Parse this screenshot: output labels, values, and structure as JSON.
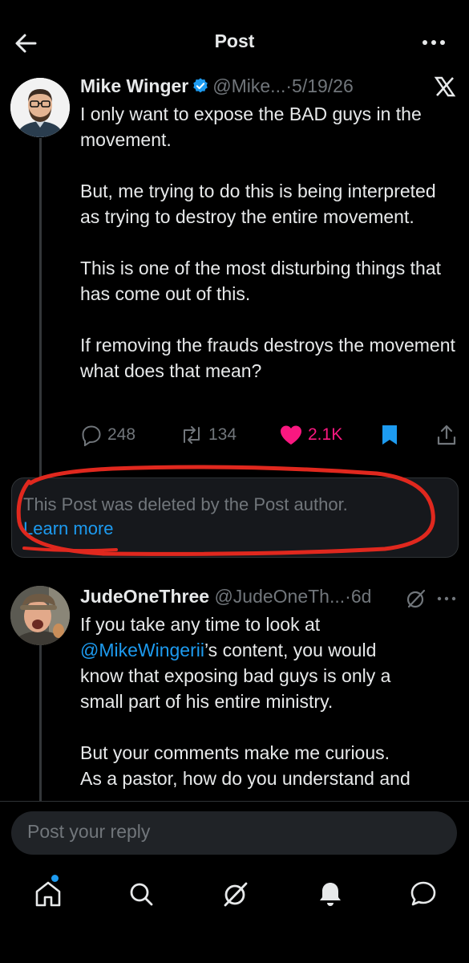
{
  "header": {
    "title": "Post"
  },
  "main_post": {
    "author_name": "Mike Winger",
    "handle": "@Mike...",
    "separator": "·",
    "date": "5/19/26",
    "paragraphs": [
      "I only want to expose the BAD guys in the movement.",
      "But, me trying to do this is being interpreted as trying to destroy the entire movement.",
      "This is one of the most disturbing things that has come out of this.",
      "If removing the frauds destroys the movement what does that mean?"
    ],
    "replies": "248",
    "reposts": "134",
    "likes": "2.1K"
  },
  "deleted_notice": {
    "message": "This Post was deleted by the Post author.",
    "link": "Learn more"
  },
  "reply_post": {
    "author_name": "JudeOneThree",
    "handle": "@JudeOneTh...",
    "separator": "·",
    "time": "6d",
    "line1": "If you take any time to look at",
    "mention": "@MikeWingerii",
    "line2_rest": "’s content, you would",
    "line3": "know that exposing bad guys is only a",
    "line4": "small part of his entire ministry.",
    "line5": "But your comments make me curious.",
    "line6": "As a pastor, how do you understand and"
  },
  "reply_box": {
    "placeholder": "Post your reply"
  },
  "colors": {
    "background": "#000000",
    "text": "#e7e9ea",
    "muted": "#71767b",
    "accent": "#1d9bf0",
    "like": "#f91880",
    "annotation": "#e0281e"
  },
  "icons": [
    "back-arrow-icon",
    "more-icon",
    "verified-icon",
    "x-logo-icon",
    "reply-icon",
    "repost-icon",
    "heart-icon",
    "bookmark-icon",
    "share-icon",
    "grok-icon",
    "home-icon",
    "search-icon",
    "bell-icon",
    "chat-icon"
  ]
}
